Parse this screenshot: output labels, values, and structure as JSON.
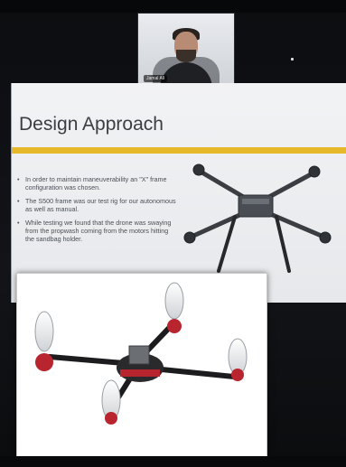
{
  "video": {
    "name_tag": "Jamal All"
  },
  "slide": {
    "title": "Design Approach",
    "bullets": [
      "In order to maintain maneuverability an \"X\" frame configuration was chosen.",
      "The S500 frame was our test rig for our autonomous as well as manual.",
      "While testing we found that the drone was swaying from the propwash coming from the motors hitting the sandbag holder."
    ],
    "accent_color": "#e8b82b"
  },
  "images": {
    "photo": "s500-quadcopter-frame-photo",
    "cad": "quadcopter-cad-render"
  }
}
